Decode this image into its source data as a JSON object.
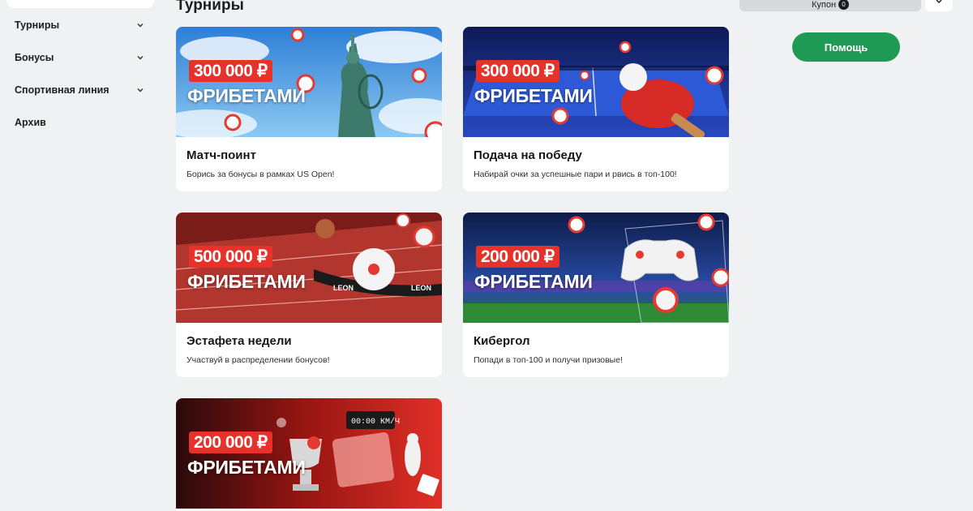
{
  "sidebar": {
    "items": [
      {
        "label": "Турниры",
        "has_chevron": true
      },
      {
        "label": "Бонусы",
        "has_chevron": true
      },
      {
        "label": "Спортивная линия",
        "has_chevron": true
      },
      {
        "label": "Архив",
        "has_chevron": false
      }
    ]
  },
  "main": {
    "title": "Турниры",
    "cards": [
      {
        "prize": "300 000 ₽",
        "freebets": "ФРИБЕТАМИ",
        "title": "Матч-поинт",
        "description": "Борись за бонусы в рамках US Open!",
        "theme": "sky-statue-tennis",
        "accent": "#4aa3e8"
      },
      {
        "prize": "300 000 ₽",
        "freebets": "ФРИБЕТАМИ",
        "title": "Подача на победу",
        "description": "Набирай очки за успешные пари и рвись в топ-100!",
        "theme": "table-tennis",
        "accent": "#1d3aa8"
      },
      {
        "prize": "500 000 ₽",
        "freebets": "ФРИБЕТАМИ",
        "title": "Эстафета недели",
        "description": "Участвуй в распределении бонусов!",
        "theme": "running-track",
        "accent": "#b3302a",
        "banner_text": "LEON"
      },
      {
        "prize": "200 000 ₽",
        "freebets": "ФРИБЕТАМИ",
        "title": "Кибергол",
        "description": "Попади в топ-100 и получи призовые!",
        "theme": "stadium-gamepad",
        "accent": "#1e3c8c"
      },
      {
        "prize": "200 000 ₽",
        "freebets": "ФРИБЕТАМИ",
        "title": "",
        "description": "",
        "theme": "red-trophy",
        "accent": "#c8211b",
        "banner_text": "00:00 КМ/Ч"
      }
    ]
  },
  "right_panel": {
    "coupon_label": "Купон",
    "coupon_count": "0",
    "help_label": "Помощь"
  },
  "colors": {
    "background": "#eff1f3",
    "prize_badge": "#e6322a",
    "help_button": "#1f9a54"
  }
}
